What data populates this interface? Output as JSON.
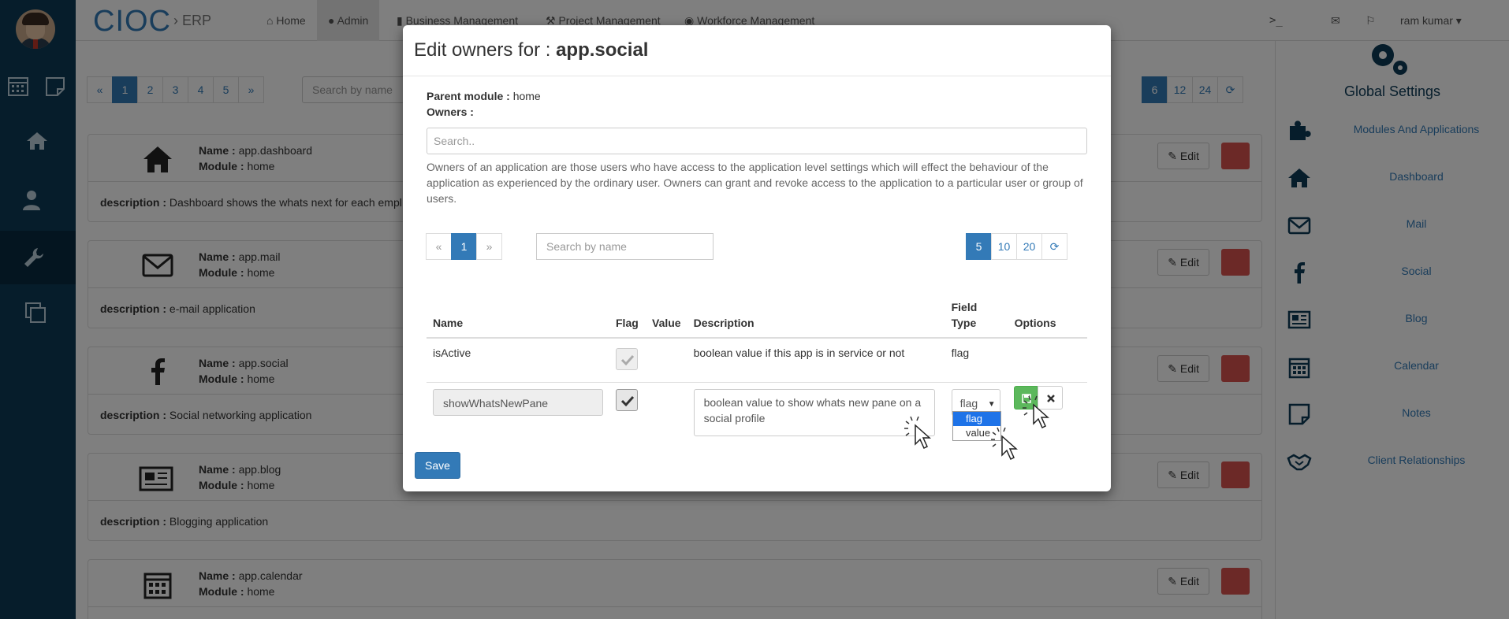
{
  "app": {
    "brand": "CIOC",
    "brand_sub": "ERP",
    "nav": [
      "Home",
      "Admin",
      "Business Management",
      "Project Management",
      "Workforce Management"
    ],
    "user": "ram kumar"
  },
  "bg_pager": {
    "prev": "«",
    "pages": [
      "1",
      "2",
      "3",
      "4",
      "5"
    ],
    "next": "»",
    "active": "1"
  },
  "bg_search_placeholder": "Search by name",
  "bg_sizes": [
    "6",
    "12",
    "24"
  ],
  "apps": [
    {
      "icon": "home-icon",
      "name": "app.dashboard",
      "module": "home",
      "description": "Dashboard shows the whats next for each empl"
    },
    {
      "icon": "mail-icon",
      "name": "app.mail",
      "module": "home",
      "description": "e-mail application"
    },
    {
      "icon": "facebook-icon",
      "name": "app.social",
      "module": "home",
      "description": "Social networking application"
    },
    {
      "icon": "newspaper-icon",
      "name": "app.blog",
      "module": "home",
      "description": "Blogging application"
    },
    {
      "icon": "calendar-icon",
      "name": "app.calendar",
      "module": "home",
      "description": ""
    }
  ],
  "labels": {
    "name": "Name :",
    "module": "Module :",
    "description": "description :",
    "edit": "Edit"
  },
  "sidebar": {
    "title": "Global Settings",
    "items": [
      "Modules And Applications",
      "Dashboard",
      "Mail",
      "Social",
      "Blog",
      "Calendar",
      "Notes",
      "Client Relationships"
    ]
  },
  "modal": {
    "title_prefix": "Edit owners for : ",
    "title_app": "app.social",
    "parent_label": "Parent module :",
    "parent_value": "home",
    "owners_label": "Owners :",
    "search_placeholder": "Search..",
    "help": "Owners of an application are those users who have access to the application level settings which will effect the behaviour of the application as experienced by the ordinary user. Owners can grant and revoke access to the application to a particular user or group of users.",
    "pager": {
      "prev": "«",
      "page": "1",
      "next": "»"
    },
    "search2_placeholder": "Search by name",
    "sizes": [
      "5",
      "10",
      "20"
    ],
    "active_size": "5",
    "columns": [
      "Name",
      "Flag",
      "Value",
      "Description",
      "Field Type",
      "Options"
    ],
    "rows": [
      {
        "name": "isActive",
        "flag": true,
        "value": "",
        "description": "boolean value if this app is in service or not",
        "field_type": "flag"
      }
    ],
    "edit_row": {
      "name": "showWhatsNewPane",
      "flag": true,
      "description": "boolean value to show whats new pane on a social profile",
      "field_type": "flag",
      "options": [
        "flag",
        "value"
      ]
    },
    "save_label": "Save"
  },
  "colors": {
    "primary": "#337ab7",
    "nav_dark": "#0d3b57",
    "danger": "#d9534f",
    "success": "#5cb85c"
  }
}
